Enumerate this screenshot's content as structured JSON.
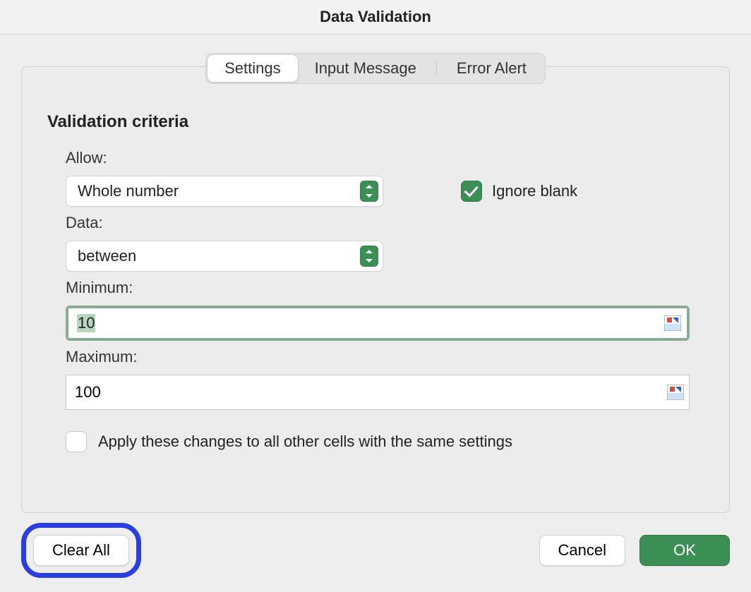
{
  "title": "Data Validation",
  "tabs": {
    "settings": "Settings",
    "input_message": "Input Message",
    "error_alert": "Error Alert"
  },
  "section_title": "Validation criteria",
  "allow": {
    "label": "Allow:",
    "value": "Whole number"
  },
  "ignore_blank": {
    "label": "Ignore blank",
    "checked": true
  },
  "data": {
    "label": "Data:",
    "value": "between"
  },
  "minimum": {
    "label": "Minimum:",
    "value": "10"
  },
  "maximum": {
    "label": "Maximum:",
    "value": "100"
  },
  "apply_all": {
    "label": "Apply these changes to all other cells with the same settings",
    "checked": false
  },
  "buttons": {
    "clear_all": "Clear All",
    "cancel": "Cancel",
    "ok": "OK"
  }
}
